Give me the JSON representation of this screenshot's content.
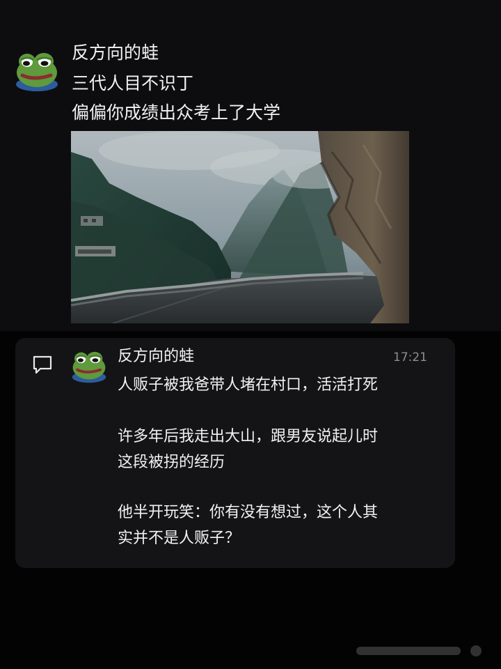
{
  "post": {
    "author": "反方向的蛙",
    "lines": [
      "三代人目不识丁",
      "偏偏你成绩出众考上了大学"
    ],
    "avatar_icon": "frog-avatar-icon",
    "image": "misty-mountain-road-photo"
  },
  "comment": {
    "icon": "comment-icon",
    "author": "反方向的蛙",
    "time": "17:21",
    "lines": [
      "人贩子被我爸带人堵在村口，活活打死",
      "许多年后我走出大山，跟男友说起儿时",
      "这段被拐的经历",
      "他半开玩笑：你有没有想过，这个人其",
      "实并不是人贩子？"
    ]
  },
  "colors": {
    "background": "#000000",
    "text": "#f2f2f2",
    "muted": "#8e8e93",
    "comment_card": "#141416"
  }
}
